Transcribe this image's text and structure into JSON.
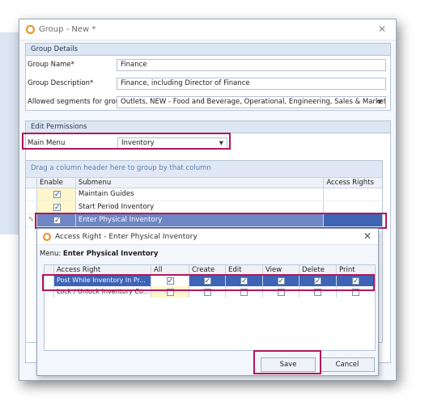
{
  "window": {
    "title": "Group - New *",
    "close_icon": "close-icon"
  },
  "group_details": {
    "header": "Group Details",
    "name_label": "Group Name*",
    "name_value": "Finance",
    "desc_label": "Group Description*",
    "desc_value": "Finance, including Director of Finance",
    "segments_label": "Allowed segments for group",
    "segments_value": "Outlets, NEW - Food and Beverage, Operational, Engineering, Sales & Market..."
  },
  "edit_permissions": {
    "header": "Edit Permissions",
    "main_menu_label": "Main Menu",
    "main_menu_value": "Inventory",
    "group_hint": "Drag a column header here to group by that column",
    "columns": [
      "Enable",
      "Submenu",
      "Access Rights"
    ],
    "rows": [
      {
        "enabled": true,
        "submenu": "Maintain Guides"
      },
      {
        "enabled": true,
        "submenu": "Start Period Inventory"
      },
      {
        "enabled": true,
        "submenu": "Enter Physical Inventory"
      }
    ]
  },
  "dialog": {
    "title": "Access Right - Enter Physical Inventory",
    "menu_label": "Menu:",
    "menu_value": "Enter Physical Inventory",
    "columns": [
      "Access Right",
      "All",
      "Create",
      "Edit",
      "View",
      "Delete",
      "Print"
    ],
    "rows": [
      {
        "name": "Post While Inventory In Pr...",
        "all": true,
        "create": true,
        "edit": true,
        "view": true,
        "delete": true,
        "print": true
      },
      {
        "name": "Lock / Unlock Inventory Co...",
        "all": false,
        "create": false,
        "edit": false,
        "view": false,
        "delete": false,
        "print": false
      }
    ],
    "save_label": "Save",
    "cancel_label": "Cancel"
  },
  "colors": {
    "accent_highlight": "#b0185e",
    "selection": "#3f63b5",
    "brand": "#f28c1e"
  }
}
